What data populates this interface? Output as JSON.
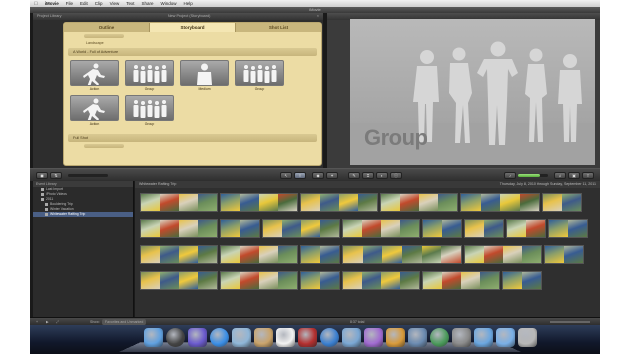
{
  "menubar": {
    "apple": "",
    "items": [
      "iMovie",
      "File",
      "Edit",
      "Clip",
      "View",
      "Text",
      "Share",
      "Window",
      "Help"
    ]
  },
  "titlebar": {
    "title": "iMovie"
  },
  "project": {
    "library_label": "Project Library",
    "title": "New Project (Storyboard)",
    "tabs": [
      "Outline",
      "Storyboard",
      "Shot List"
    ],
    "landscape_label": "Landscape",
    "section1": "A World - Full of Adventure",
    "row1_clips": [
      {
        "caption": "Action",
        "icon": "running-person-icon"
      },
      {
        "caption": "Group",
        "icon": "group-silhouette-icon"
      },
      {
        "caption": "Medium",
        "icon": "person-silhouette-icon"
      },
      {
        "caption": "Group",
        "icon": "group-silhouette-icon"
      }
    ],
    "row2_clips": [
      {
        "caption": "Action",
        "icon": "running-person-icon"
      },
      {
        "caption": "Group",
        "icon": "group-silhouette-icon"
      }
    ],
    "section2": "Full Shot"
  },
  "preview": {
    "label": "Group"
  },
  "toolbar": {
    "volume_level": 0.73,
    "buttons": [
      "camera-icon",
      "mic-icon",
      "select-icon",
      "list-icon",
      "chapter-icon",
      "keyword-icon",
      "wrench-icon",
      "crop-icon",
      "settings-icon",
      "clock-icon"
    ]
  },
  "library": {
    "header": "Event Library",
    "items": [
      {
        "label": "Last Import",
        "selected": false
      },
      {
        "label": "iPhoto Videos",
        "selected": false
      },
      {
        "label": "2011",
        "selected": false
      },
      {
        "label": "Bouldering Trip",
        "selected": false
      },
      {
        "label": "Winter Vacation",
        "selected": false
      },
      {
        "label": "Whitewater Rafting Trip",
        "selected": true
      }
    ]
  },
  "browser": {
    "event_title": "Whitewater Rafting Trip",
    "date_range": "Thursday, July 8, 2010 through Sunday, September 11, 2011"
  },
  "bottombar": {
    "show_label": "Show:",
    "filter": "Favorites and Unmarked",
    "clip_count": "8:37 total"
  },
  "colors": {
    "storyboard_bg": "#ecdca4",
    "selected_item": "#4a5f85",
    "volume_green": "#57b03a"
  }
}
